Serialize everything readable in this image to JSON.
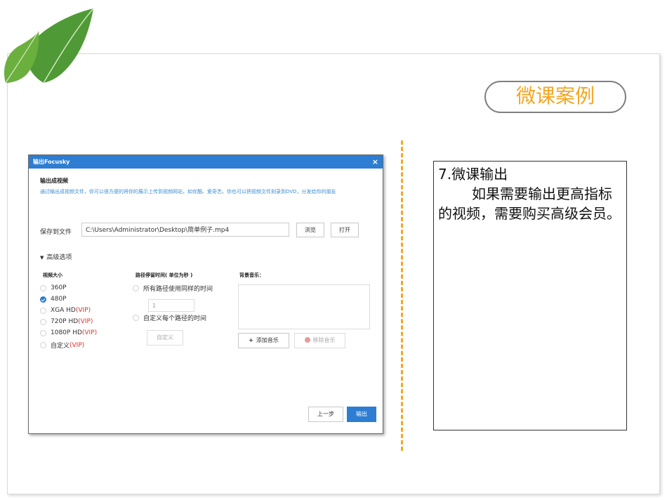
{
  "slide": {
    "badge": "微课案例",
    "text_heading": "7.微课输出",
    "text_body": "如果需要输出更高指标的视频，需要购买高级会员。"
  },
  "dialog": {
    "title": "输出Focusky",
    "close_icon": "close-icon",
    "section_title": "输出成视频",
    "section_desc": "通过输出成视频文件，你可以很方便的将你的展示上传到视频网站，如优酷、爱奇艺。你也可以把视频文件刻录到DVD，分发给你的朋友",
    "save_label": "保存到文件",
    "save_path": "C:\\Users\\Administrator\\Desktop\\简单例子.mp4",
    "browse_label": "浏览",
    "open_label": "打开",
    "advanced_label": "高级选项",
    "video_size_title": "视频大小",
    "sizes": [
      {
        "label": "360P",
        "vip": "",
        "selected": false
      },
      {
        "label": "480P",
        "vip": "",
        "selected": true
      },
      {
        "label": "XGA HD",
        "vip": "(VIP)",
        "selected": false
      },
      {
        "label": "720P HD",
        "vip": "(VIP)",
        "selected": false
      },
      {
        "label": "1080P HD",
        "vip": "(VIP)",
        "selected": false
      },
      {
        "label": "自定义",
        "vip": "(VIP)",
        "selected": false
      }
    ],
    "path_time_title": "路径停留时间( 单位为秒 )",
    "same_time_label": "所有路径使用同样的时间",
    "time_value": "1",
    "custom_time_label": "自定义每个路径的时间",
    "custom_button": "自定义",
    "music_title": "背景音乐：",
    "add_music_label": "添加音乐",
    "remove_music_label": "移除音乐",
    "prev_label": "上一步",
    "export_label": "输出"
  },
  "colors": {
    "accent": "#f5a623",
    "primary": "#2d7dd2",
    "vip": "#e0312a",
    "leaf": "#5a9a3a"
  }
}
